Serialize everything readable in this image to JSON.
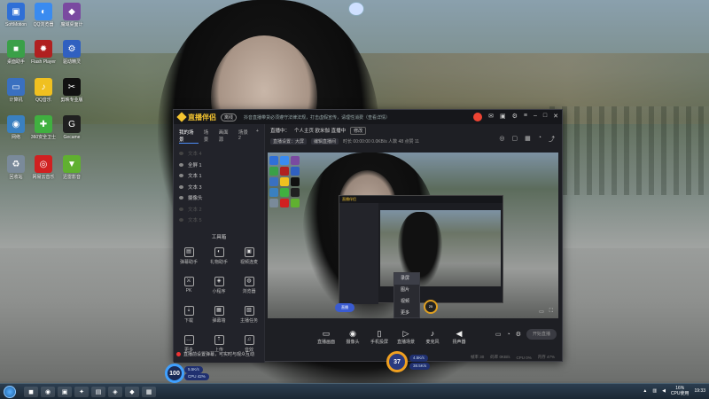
{
  "desktop": {
    "icons": [
      {
        "label": "SoftMotion",
        "color": "#2f6fd6",
        "glyph": "▣"
      },
      {
        "label": "QQ浏览器",
        "color": "#3a8bf0",
        "glyph": "◐"
      },
      {
        "label": "魔域桌面计",
        "color": "#7a4aa0",
        "glyph": "◆"
      },
      {
        "label": "桌面助手",
        "color": "#3aa048",
        "glyph": "■"
      },
      {
        "label": "Flash Player",
        "color": "#b02020",
        "glyph": "✹"
      },
      {
        "label": "驱动精灵",
        "color": "#3060c0",
        "glyph": "⚙"
      },
      {
        "label": "计算机",
        "color": "#3a70c0",
        "glyph": "▭"
      },
      {
        "label": "QQ音乐",
        "color": "#f0c020",
        "glyph": "♪"
      },
      {
        "label": "剪映专业版",
        "color": "#111111",
        "glyph": "✂"
      },
      {
        "label": "网络",
        "color": "#3a80c0",
        "glyph": "◉"
      },
      {
        "label": "360安全卫士",
        "color": "#40b040",
        "glyph": "✚"
      },
      {
        "label": "Gecame",
        "color": "#202020",
        "glyph": "G"
      },
      {
        "label": "回收站",
        "color": "#7a8a9a",
        "glyph": "♻"
      },
      {
        "label": "网易云音乐",
        "color": "#d02020",
        "glyph": "◎"
      },
      {
        "label": "迅雷影音",
        "color": "#60b030",
        "glyph": "▼"
      }
    ]
  },
  "window": {
    "app_name": "直播伴侣",
    "status_badge": "离线",
    "notice": "抖音直播带货必须遵守法律法规，打击虚假宣传，请理性消费（查看详情）",
    "left_tabs": [
      "我的场景",
      "场景",
      "画面源",
      "场景2"
    ],
    "add_tab": "+",
    "sources": [
      {
        "label": "文本 4",
        "dim": true
      },
      {
        "label": "全屏 1",
        "dim": false
      },
      {
        "label": "文本 1",
        "dim": false
      },
      {
        "label": "文本 3",
        "dim": false
      },
      {
        "label": "摄像头",
        "dim": false
      },
      {
        "label": "文本 2",
        "dim": true
      },
      {
        "label": "文本 5",
        "dim": true
      }
    ],
    "toolbox_title": "工具箱",
    "tools": [
      {
        "label": "弹幕助手",
        "glyph": "▤"
      },
      {
        "label": "礼物助手",
        "glyph": "◐"
      },
      {
        "label": "视频连麦",
        "glyph": "▣"
      },
      {
        "label": "PK",
        "glyph": "⚔"
      },
      {
        "label": "小程序",
        "glyph": "◈"
      },
      {
        "label": "浏览器",
        "glyph": "◍"
      },
      {
        "label": "下载",
        "glyph": "⇣"
      },
      {
        "label": "弹幕墙",
        "glyph": "▦"
      },
      {
        "label": "主播任务",
        "glyph": "▧"
      },
      {
        "label": "更多",
        "glyph": "…"
      },
      {
        "label": "上传",
        "glyph": "⇡"
      },
      {
        "label": "音效",
        "glyph": "♫"
      }
    ],
    "bottom_notice": "直播前设置弹幕，可实时与观众互动",
    "info": {
      "status": "直播中：",
      "title": "个人主页 欧米伽 直播中",
      "edit": "修改",
      "tag1": "直播设置：大屏",
      "tag2": "编辑直播间",
      "stats": "时长 00:00:00  0.0KB/s  人数 48  点赞 11"
    },
    "context_menu": [
      "录屏",
      "图片",
      "视频",
      "更多"
    ],
    "mini_badge": "直播",
    "mini_gauge": "25",
    "controls": [
      {
        "label": "直播画面",
        "glyph": "▭"
      },
      {
        "label": "摄像头",
        "glyph": "◉"
      },
      {
        "label": "手机投屏",
        "glyph": "▯"
      },
      {
        "label": "直播场景",
        "glyph": "▷"
      },
      {
        "label": "麦克风",
        "glyph": "♪"
      },
      {
        "label": "扬声器",
        "glyph": "◀"
      }
    ],
    "live_button": "开始直播",
    "statusbar": [
      "帧率 30",
      "码率 0KB/s",
      "CPU 0%",
      "内存 47%"
    ]
  },
  "perf": {
    "left_gauge": "100",
    "left_pill1": "5.5K/s",
    "left_pill2": "CPU 42%",
    "center_gauge": "37",
    "center_pill1": "4.5K/s",
    "center_pill2": "38.5K/s"
  },
  "taskbar": {
    "apps": [
      "◼",
      "◉",
      "▣",
      "✦",
      "▤",
      "◈",
      "◆",
      "▦"
    ],
    "cpu_value": "16%",
    "cpu_label": "CPU使用",
    "clock": "19:33"
  }
}
